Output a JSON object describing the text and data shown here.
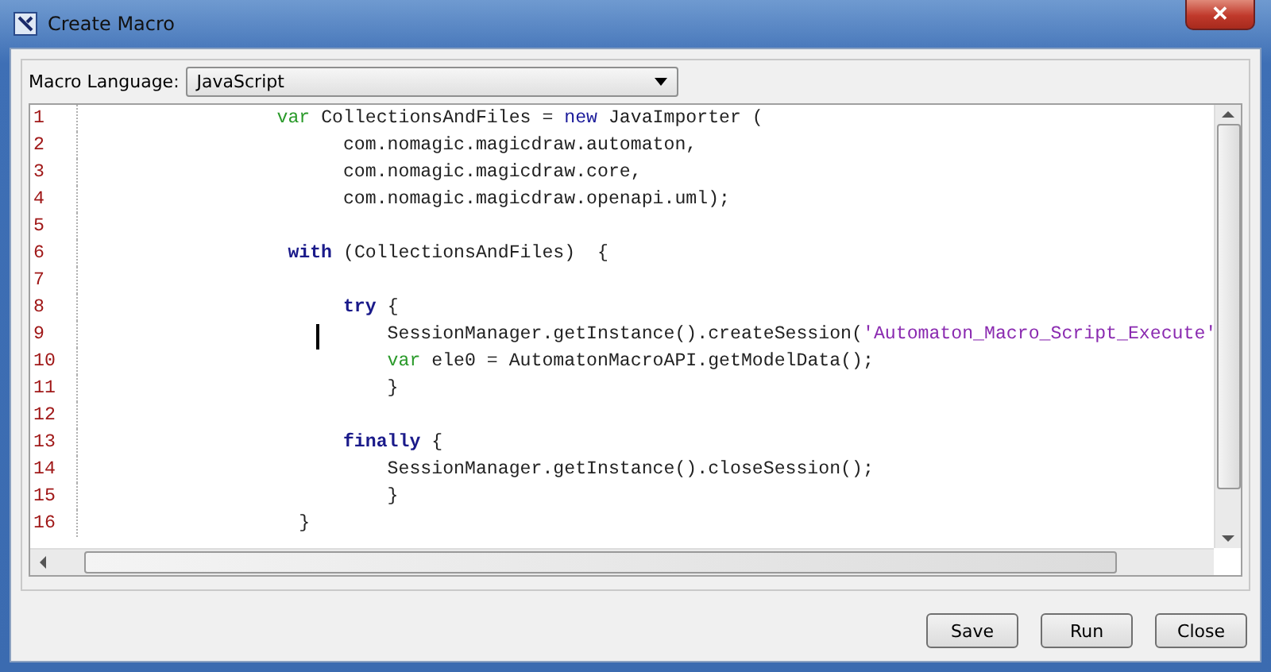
{
  "window": {
    "title": "Create Macro",
    "close": "✕"
  },
  "language": {
    "label": "Macro Language:",
    "value": "JavaScript"
  },
  "code": [
    {
      "number": "1",
      "segments": [
        {
          "kind": "var",
          "text": "                  var"
        },
        {
          "kind": "plain",
          "text": " CollectionsAndFiles = "
        },
        {
          "kind": "keyword",
          "text": "new"
        },
        {
          "kind": "plain",
          "text": " JavaImporter ("
        }
      ]
    },
    {
      "number": "2",
      "segments": [
        {
          "kind": "plain",
          "text": "                        com.nomagic.magicdraw.automaton,"
        }
      ]
    },
    {
      "number": "3",
      "segments": [
        {
          "kind": "plain",
          "text": "                        com.nomagic.magicdraw.core,"
        }
      ]
    },
    {
      "number": "4",
      "segments": [
        {
          "kind": "plain",
          "text": "                        com.nomagic.magicdraw.openapi.uml);"
        }
      ]
    },
    {
      "number": "5"
    },
    {
      "number": "6",
      "segments": [
        {
          "kind": "bold",
          "text": "                   with"
        },
        {
          "kind": "plain",
          "text": " (CollectionsAndFiles)  {"
        }
      ]
    },
    {
      "number": "7"
    },
    {
      "number": "8",
      "segments": [
        {
          "kind": "bold",
          "text": "                        try"
        },
        {
          "kind": "plain",
          "text": " {"
        }
      ]
    },
    {
      "number": "9",
      "segments": [
        {
          "kind": "plain",
          "text": "                            SessionManager.getInstance().createSession("
        },
        {
          "kind": "string",
          "text": "'Automaton_Macro_Script_Execute'"
        }
      ],
      "cursor": true
    },
    {
      "number": "10",
      "segments": [
        {
          "kind": "var",
          "text": "                            var"
        },
        {
          "kind": "plain",
          "text": " ele0 = AutomatonMacroAPI.getModelData();"
        }
      ]
    },
    {
      "number": "11",
      "segments": [
        {
          "kind": "plain",
          "text": "                            }"
        }
      ]
    },
    {
      "number": "12"
    },
    {
      "number": "13",
      "segments": [
        {
          "kind": "bold",
          "text": "                        finally"
        },
        {
          "kind": "plain",
          "text": " {"
        }
      ]
    },
    {
      "number": "14",
      "segments": [
        {
          "kind": "plain",
          "text": "                            SessionManager.getInstance().closeSession();"
        }
      ]
    },
    {
      "number": "15",
      "segments": [
        {
          "kind": "plain",
          "text": "                            }"
        }
      ]
    },
    {
      "number": "16",
      "segments": [
        {
          "kind": "plain",
          "text": "                    }"
        }
      ]
    }
  ],
  "buttons": [
    "Save",
    "Run",
    "Close"
  ]
}
